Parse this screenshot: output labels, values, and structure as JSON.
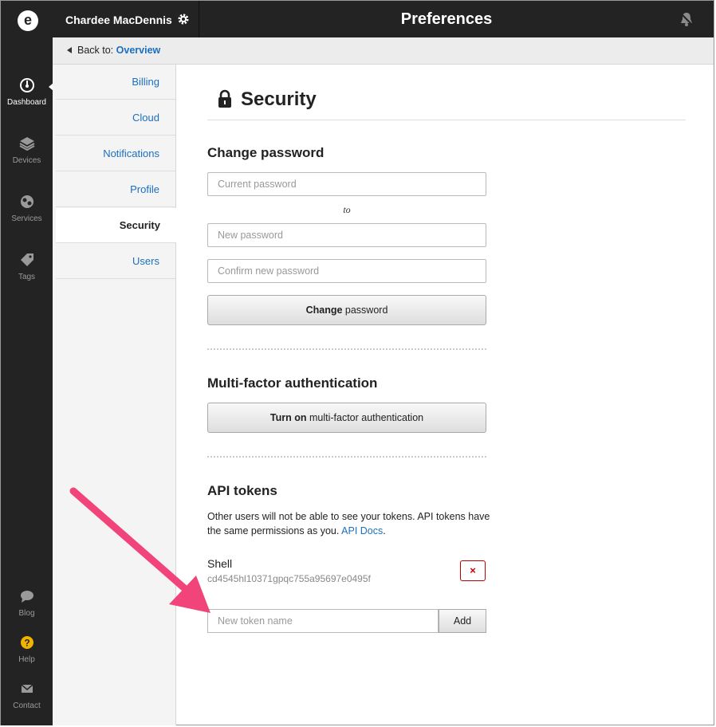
{
  "header": {
    "user_name": "Chardee MacDennis",
    "page_title": "Preferences"
  },
  "rail": {
    "logo_letter": "e",
    "items": [
      {
        "label": "Dashboard",
        "icon": "gauge-icon"
      },
      {
        "label": "Devices",
        "icon": "layers-icon"
      },
      {
        "label": "Services",
        "icon": "cloud-icon"
      },
      {
        "label": "Tags",
        "icon": "tag-icon"
      }
    ],
    "bottom_items": [
      {
        "label": "Blog",
        "icon": "speech-bubble-icon"
      },
      {
        "label": "Help",
        "icon": "question-icon"
      },
      {
        "label": "Contact",
        "icon": "envelope-icon"
      }
    ]
  },
  "breadcrumb": {
    "prefix": "Back to:",
    "link": "Overview"
  },
  "subnav": {
    "items": [
      "Billing",
      "Cloud",
      "Notifications",
      "Profile",
      "Security",
      "Users"
    ],
    "active": "Security"
  },
  "main": {
    "title": "Security",
    "change_password": {
      "heading": "Change password",
      "current_placeholder": "Current password",
      "to_label": "to",
      "new_placeholder": "New password",
      "confirm_placeholder": "Confirm new password",
      "button_bold": "Change",
      "button_rest": "password"
    },
    "mfa": {
      "heading": "Multi-factor authentication",
      "button_bold": "Turn on",
      "button_rest": "multi-factor authentication"
    },
    "api_tokens": {
      "heading": "API tokens",
      "description": "Other users will not be able to see your tokens. API tokens have the same permissions as you.",
      "docs_link": "API Docs",
      "docs_suffix": ".",
      "tokens": [
        {
          "name": "Shell",
          "value": "cd4545hl10371gpqc755a95697e0495f"
        }
      ],
      "delete_label": "×",
      "new_token_placeholder": "New token name",
      "add_label": "Add"
    }
  },
  "colors": {
    "dark": "#232323",
    "link": "#1a6fc0",
    "annotation_arrow": "#f0447a",
    "delete_red": "#cc0000"
  }
}
